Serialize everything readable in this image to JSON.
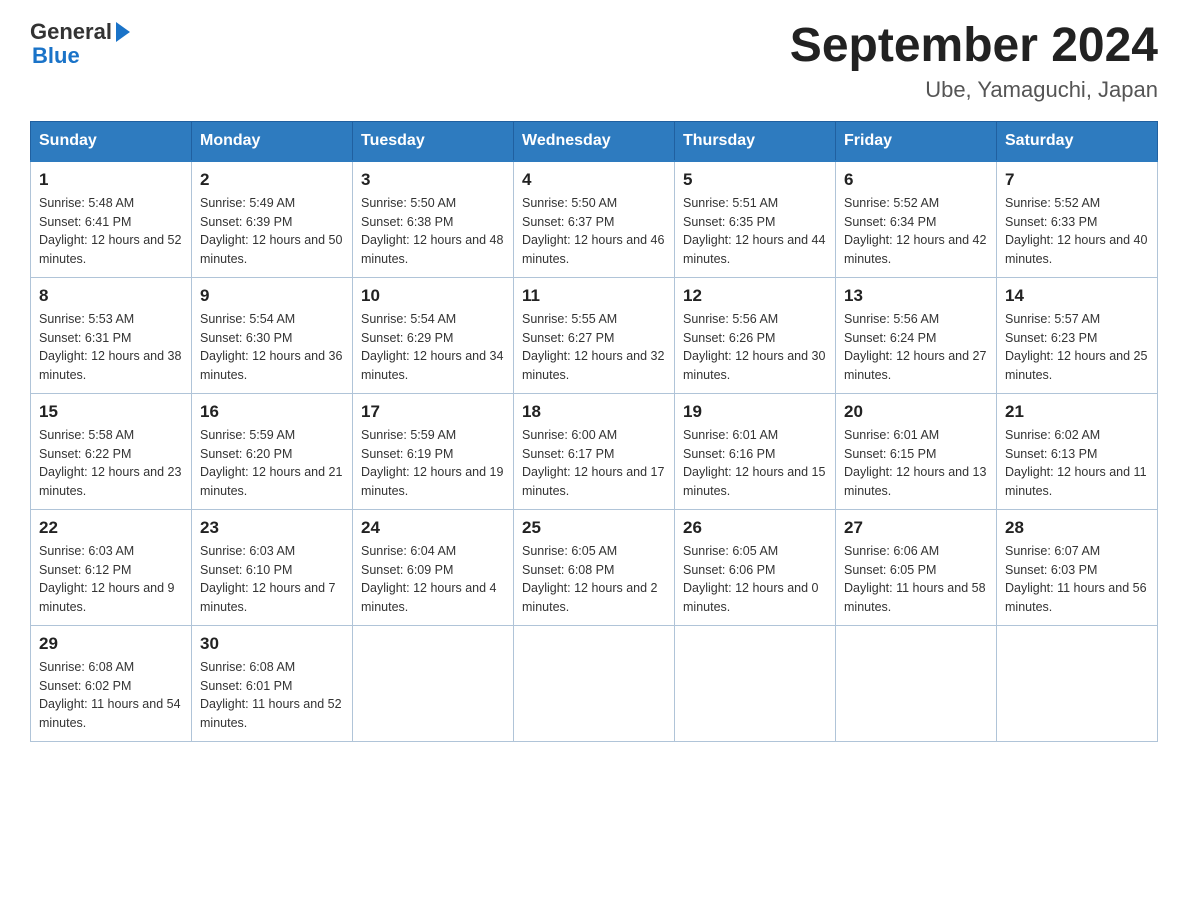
{
  "header": {
    "logo_general": "General",
    "logo_triangle": "",
    "logo_blue": "Blue",
    "title": "September 2024",
    "subtitle": "Ube, Yamaguchi, Japan"
  },
  "calendar": {
    "columns": [
      "Sunday",
      "Monday",
      "Tuesday",
      "Wednesday",
      "Thursday",
      "Friday",
      "Saturday"
    ],
    "weeks": [
      [
        {
          "day": "1",
          "sunrise": "Sunrise: 5:48 AM",
          "sunset": "Sunset: 6:41 PM",
          "daylight": "Daylight: 12 hours and 52 minutes."
        },
        {
          "day": "2",
          "sunrise": "Sunrise: 5:49 AM",
          "sunset": "Sunset: 6:39 PM",
          "daylight": "Daylight: 12 hours and 50 minutes."
        },
        {
          "day": "3",
          "sunrise": "Sunrise: 5:50 AM",
          "sunset": "Sunset: 6:38 PM",
          "daylight": "Daylight: 12 hours and 48 minutes."
        },
        {
          "day": "4",
          "sunrise": "Sunrise: 5:50 AM",
          "sunset": "Sunset: 6:37 PM",
          "daylight": "Daylight: 12 hours and 46 minutes."
        },
        {
          "day": "5",
          "sunrise": "Sunrise: 5:51 AM",
          "sunset": "Sunset: 6:35 PM",
          "daylight": "Daylight: 12 hours and 44 minutes."
        },
        {
          "day": "6",
          "sunrise": "Sunrise: 5:52 AM",
          "sunset": "Sunset: 6:34 PM",
          "daylight": "Daylight: 12 hours and 42 minutes."
        },
        {
          "day": "7",
          "sunrise": "Sunrise: 5:52 AM",
          "sunset": "Sunset: 6:33 PM",
          "daylight": "Daylight: 12 hours and 40 minutes."
        }
      ],
      [
        {
          "day": "8",
          "sunrise": "Sunrise: 5:53 AM",
          "sunset": "Sunset: 6:31 PM",
          "daylight": "Daylight: 12 hours and 38 minutes."
        },
        {
          "day": "9",
          "sunrise": "Sunrise: 5:54 AM",
          "sunset": "Sunset: 6:30 PM",
          "daylight": "Daylight: 12 hours and 36 minutes."
        },
        {
          "day": "10",
          "sunrise": "Sunrise: 5:54 AM",
          "sunset": "Sunset: 6:29 PM",
          "daylight": "Daylight: 12 hours and 34 minutes."
        },
        {
          "day": "11",
          "sunrise": "Sunrise: 5:55 AM",
          "sunset": "Sunset: 6:27 PM",
          "daylight": "Daylight: 12 hours and 32 minutes."
        },
        {
          "day": "12",
          "sunrise": "Sunrise: 5:56 AM",
          "sunset": "Sunset: 6:26 PM",
          "daylight": "Daylight: 12 hours and 30 minutes."
        },
        {
          "day": "13",
          "sunrise": "Sunrise: 5:56 AM",
          "sunset": "Sunset: 6:24 PM",
          "daylight": "Daylight: 12 hours and 27 minutes."
        },
        {
          "day": "14",
          "sunrise": "Sunrise: 5:57 AM",
          "sunset": "Sunset: 6:23 PM",
          "daylight": "Daylight: 12 hours and 25 minutes."
        }
      ],
      [
        {
          "day": "15",
          "sunrise": "Sunrise: 5:58 AM",
          "sunset": "Sunset: 6:22 PM",
          "daylight": "Daylight: 12 hours and 23 minutes."
        },
        {
          "day": "16",
          "sunrise": "Sunrise: 5:59 AM",
          "sunset": "Sunset: 6:20 PM",
          "daylight": "Daylight: 12 hours and 21 minutes."
        },
        {
          "day": "17",
          "sunrise": "Sunrise: 5:59 AM",
          "sunset": "Sunset: 6:19 PM",
          "daylight": "Daylight: 12 hours and 19 minutes."
        },
        {
          "day": "18",
          "sunrise": "Sunrise: 6:00 AM",
          "sunset": "Sunset: 6:17 PM",
          "daylight": "Daylight: 12 hours and 17 minutes."
        },
        {
          "day": "19",
          "sunrise": "Sunrise: 6:01 AM",
          "sunset": "Sunset: 6:16 PM",
          "daylight": "Daylight: 12 hours and 15 minutes."
        },
        {
          "day": "20",
          "sunrise": "Sunrise: 6:01 AM",
          "sunset": "Sunset: 6:15 PM",
          "daylight": "Daylight: 12 hours and 13 minutes."
        },
        {
          "day": "21",
          "sunrise": "Sunrise: 6:02 AM",
          "sunset": "Sunset: 6:13 PM",
          "daylight": "Daylight: 12 hours and 11 minutes."
        }
      ],
      [
        {
          "day": "22",
          "sunrise": "Sunrise: 6:03 AM",
          "sunset": "Sunset: 6:12 PM",
          "daylight": "Daylight: 12 hours and 9 minutes."
        },
        {
          "day": "23",
          "sunrise": "Sunrise: 6:03 AM",
          "sunset": "Sunset: 6:10 PM",
          "daylight": "Daylight: 12 hours and 7 minutes."
        },
        {
          "day": "24",
          "sunrise": "Sunrise: 6:04 AM",
          "sunset": "Sunset: 6:09 PM",
          "daylight": "Daylight: 12 hours and 4 minutes."
        },
        {
          "day": "25",
          "sunrise": "Sunrise: 6:05 AM",
          "sunset": "Sunset: 6:08 PM",
          "daylight": "Daylight: 12 hours and 2 minutes."
        },
        {
          "day": "26",
          "sunrise": "Sunrise: 6:05 AM",
          "sunset": "Sunset: 6:06 PM",
          "daylight": "Daylight: 12 hours and 0 minutes."
        },
        {
          "day": "27",
          "sunrise": "Sunrise: 6:06 AM",
          "sunset": "Sunset: 6:05 PM",
          "daylight": "Daylight: 11 hours and 58 minutes."
        },
        {
          "day": "28",
          "sunrise": "Sunrise: 6:07 AM",
          "sunset": "Sunset: 6:03 PM",
          "daylight": "Daylight: 11 hours and 56 minutes."
        }
      ],
      [
        {
          "day": "29",
          "sunrise": "Sunrise: 6:08 AM",
          "sunset": "Sunset: 6:02 PM",
          "daylight": "Daylight: 11 hours and 54 minutes."
        },
        {
          "day": "30",
          "sunrise": "Sunrise: 6:08 AM",
          "sunset": "Sunset: 6:01 PM",
          "daylight": "Daylight: 11 hours and 52 minutes."
        },
        null,
        null,
        null,
        null,
        null
      ]
    ]
  }
}
